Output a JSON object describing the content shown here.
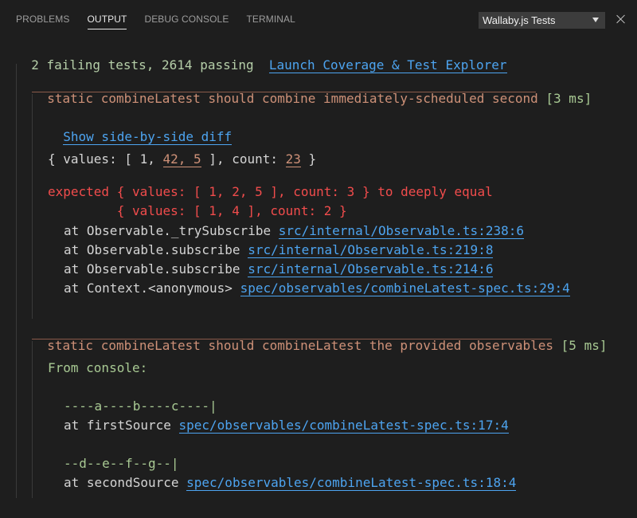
{
  "tabs": [
    {
      "label": "PROBLEMS",
      "active": false
    },
    {
      "label": "OUTPUT",
      "active": true
    },
    {
      "label": "DEBUG CONSOLE",
      "active": false
    },
    {
      "label": "TERMINAL",
      "active": false
    }
  ],
  "channel_select": {
    "value": "Wallaby.js Tests"
  },
  "summary": {
    "text": "2 failing tests, 2614 passing",
    "launch_link": "Launch Coverage & Test Explorer"
  },
  "test1": {
    "title": "static combineLatest should combine immediately-scheduled second",
    "duration": "[3 ms]",
    "diff_link": "Show side-by-side diff",
    "actual": {
      "prefix": "{ values: [ 1, ",
      "diff_values": "42, 5",
      "mid": " ], count: ",
      "diff_count": "23",
      "suffix": " }"
    },
    "expected_line1": "expected { values: [ 1, 2, 5 ], count: 3 } to deeply equal",
    "expected_line2": "         { values: [ 1, 4 ], count: 2 }",
    "stack": [
      {
        "at": "at Observable._trySubscribe",
        "link": "src/internal/Observable.ts:238:6"
      },
      {
        "at": "at Observable.subscribe",
        "link": "src/internal/Observable.ts:219:8"
      },
      {
        "at": "at Observable.subscribe",
        "link": "src/internal/Observable.ts:214:6"
      },
      {
        "at": "at Context.<anonymous>",
        "link": "spec/observables/combineLatest-spec.ts:29:4"
      }
    ]
  },
  "test2": {
    "title": "static combineLatest should combineLatest the provided observables",
    "duration": "[5 ms]",
    "console_label": "From console:",
    "logs": [
      {
        "value": "----a----b----c----|",
        "at": "at firstSource",
        "link": "spec/observables/combineLatest-spec.ts:17:4"
      },
      {
        "value": "--d--e--f--g--|",
        "at": "at secondSource",
        "link": "spec/observables/combineLatest-spec.ts:18:4"
      }
    ]
  }
}
